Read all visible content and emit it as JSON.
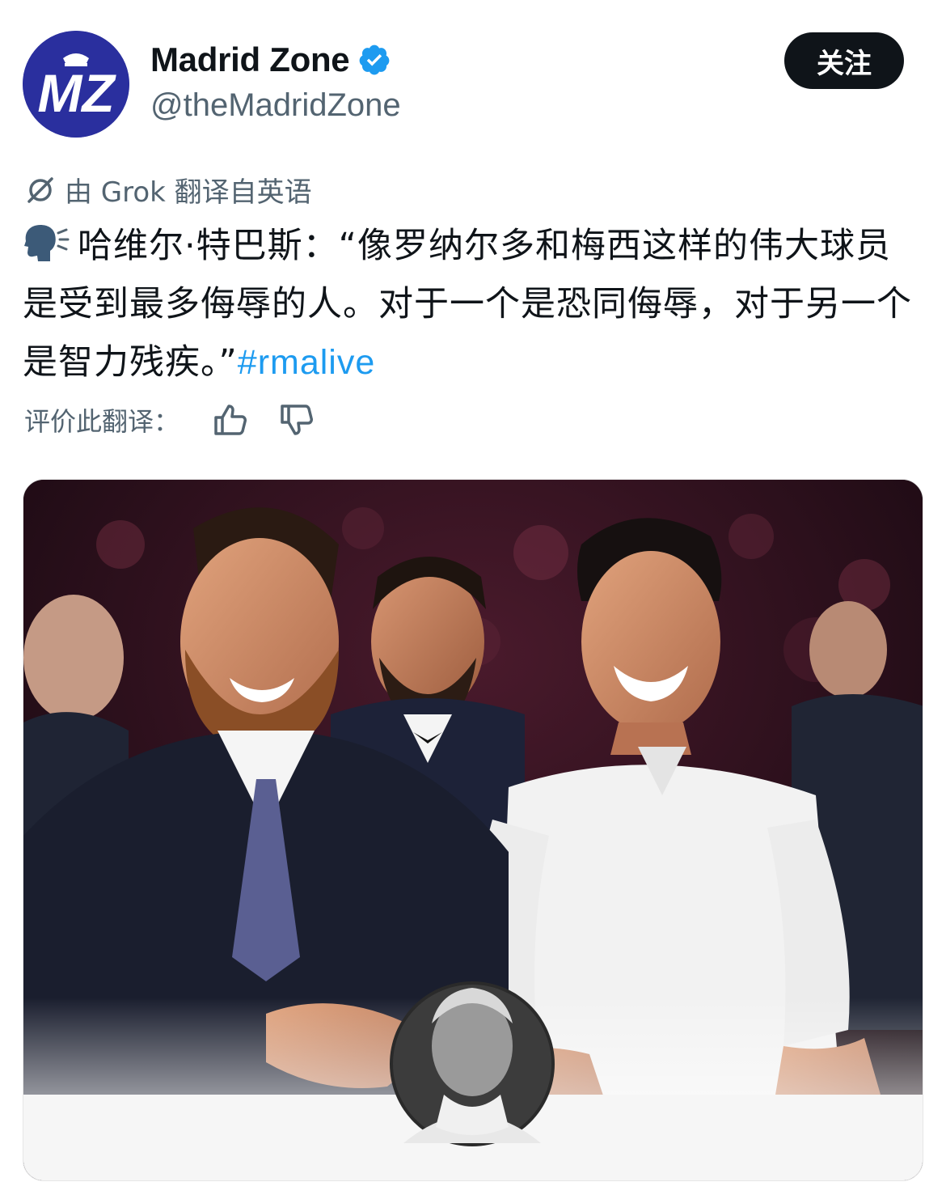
{
  "account": {
    "display_name": "Madrid Zone",
    "handle": "@theMadridZone",
    "avatar_text": "MZ",
    "follow_label": "关注"
  },
  "translation": {
    "notice": "由 Grok 翻译自英语",
    "rate_label": "评价此翻译："
  },
  "tweet": {
    "text": "哈维尔·特巴斯：“像罗纳尔多和梅西这样的伟大球员是受到最多侮辱的人。对于一个是恐同侮辱，对于另一个是智力残疾。”",
    "hashtag": "#rmalive"
  },
  "icons": {
    "verified": "verified-badge-icon",
    "grok": "grok-icon",
    "speaking": "speaking-head-icon",
    "thumbs_up": "thumbs-up-icon",
    "thumbs_down": "thumbs-down-icon"
  },
  "colors": {
    "avatar_bg": "#2a2f9e",
    "verified": "#1d9bf0",
    "hashtag": "#1d9bf0",
    "follow_bg": "#0f1419",
    "muted": "#536471"
  }
}
